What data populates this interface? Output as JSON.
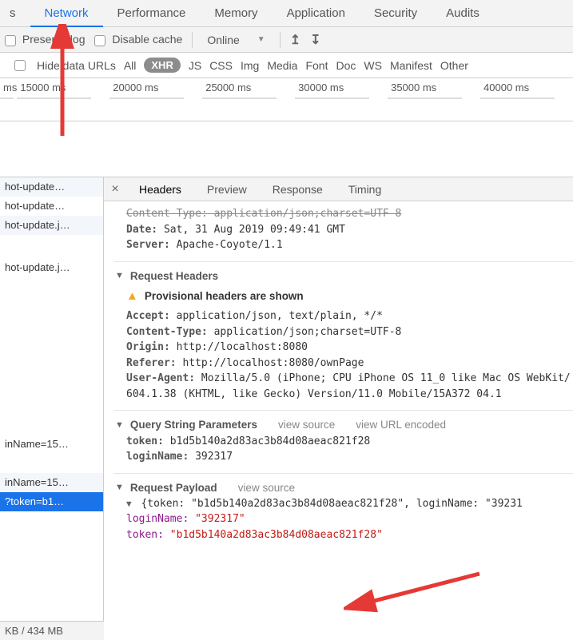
{
  "tabs": {
    "partial_left": "s",
    "network": "Network",
    "performance": "Performance",
    "memory": "Memory",
    "application": "Application",
    "security": "Security",
    "audits": "Audits"
  },
  "toolbar": {
    "preserve_log": "Preserve log",
    "disable_cache": "Disable cache",
    "throttle": "Online",
    "upload_icon": "↥",
    "download_icon": "↧"
  },
  "filter": {
    "hide_data_urls": "Hide data URLs",
    "all": "All",
    "xhr": "XHR",
    "js": "JS",
    "css": "CSS",
    "img": "Img",
    "media": "Media",
    "font": "Font",
    "doc": "Doc",
    "ws": "WS",
    "manifest": "Manifest",
    "other": "Other"
  },
  "timeline": {
    "t0": "ms",
    "t1": "15000 ms",
    "t2": "20000 ms",
    "t3": "25000 ms",
    "t4": "30000 ms",
    "t5": "35000 ms",
    "t6": "40000 ms"
  },
  "requests": {
    "r0": "hot-update…",
    "r1": "hot-update…",
    "r2": "hot-update.j…",
    "r3": "hot-update.j…",
    "r4": "inName=15…",
    "r5": "inName=15…",
    "r6": "?token=b1…"
  },
  "detail_tabs": {
    "close": "×",
    "headers": "Headers",
    "preview": "Preview",
    "response": "Response",
    "timing": "Timing"
  },
  "resp_hdr": {
    "cut": "Content-Type: application/json;charset=UTF-8",
    "date_k": "Date:",
    "date_v": "Sat, 31 Aug 2019 09:49:41 GMT",
    "server_k": "Server:",
    "server_v": "Apache-Coyote/1.1"
  },
  "req_hdr_section": "Request Headers",
  "provisional": "Provisional headers are shown",
  "req_hdr": {
    "accept_k": "Accept:",
    "accept_v": "application/json, text/plain, */*",
    "ct_k": "Content-Type:",
    "ct_v": "application/json;charset=UTF-8",
    "origin_k": "Origin:",
    "origin_v": "http://localhost:8080",
    "referer_k": "Referer:",
    "referer_v": "http://localhost:8080/ownPage",
    "ua_k": "User-Agent:",
    "ua_v": "Mozilla/5.0 (iPhone; CPU iPhone OS 11_0 like Mac OS WebKit/604.1.38 (KHTML, like Gecko) Version/11.0 Mobile/15A372 04.1"
  },
  "qsp_section": "Query String Parameters",
  "view_source": "view source",
  "view_url_encoded": "view URL encoded",
  "qsp": {
    "token_k": "token:",
    "token_v": "b1d5b140a2d83ac3b84d08aeac821f28",
    "login_k": "loginName:",
    "login_v": "392317"
  },
  "payload_section": "Request Payload",
  "payload": {
    "obj_open": "{token: \"b1d5b140a2d83ac3b84d08aeac821f28\", loginName: \"39231",
    "login_k": "loginName:",
    "login_v": "\"392317\"",
    "token_k": "token:",
    "token_v": "\"b1d5b140a2d83ac3b84d08aeac821f28\""
  },
  "status": "KB / 434 MB"
}
